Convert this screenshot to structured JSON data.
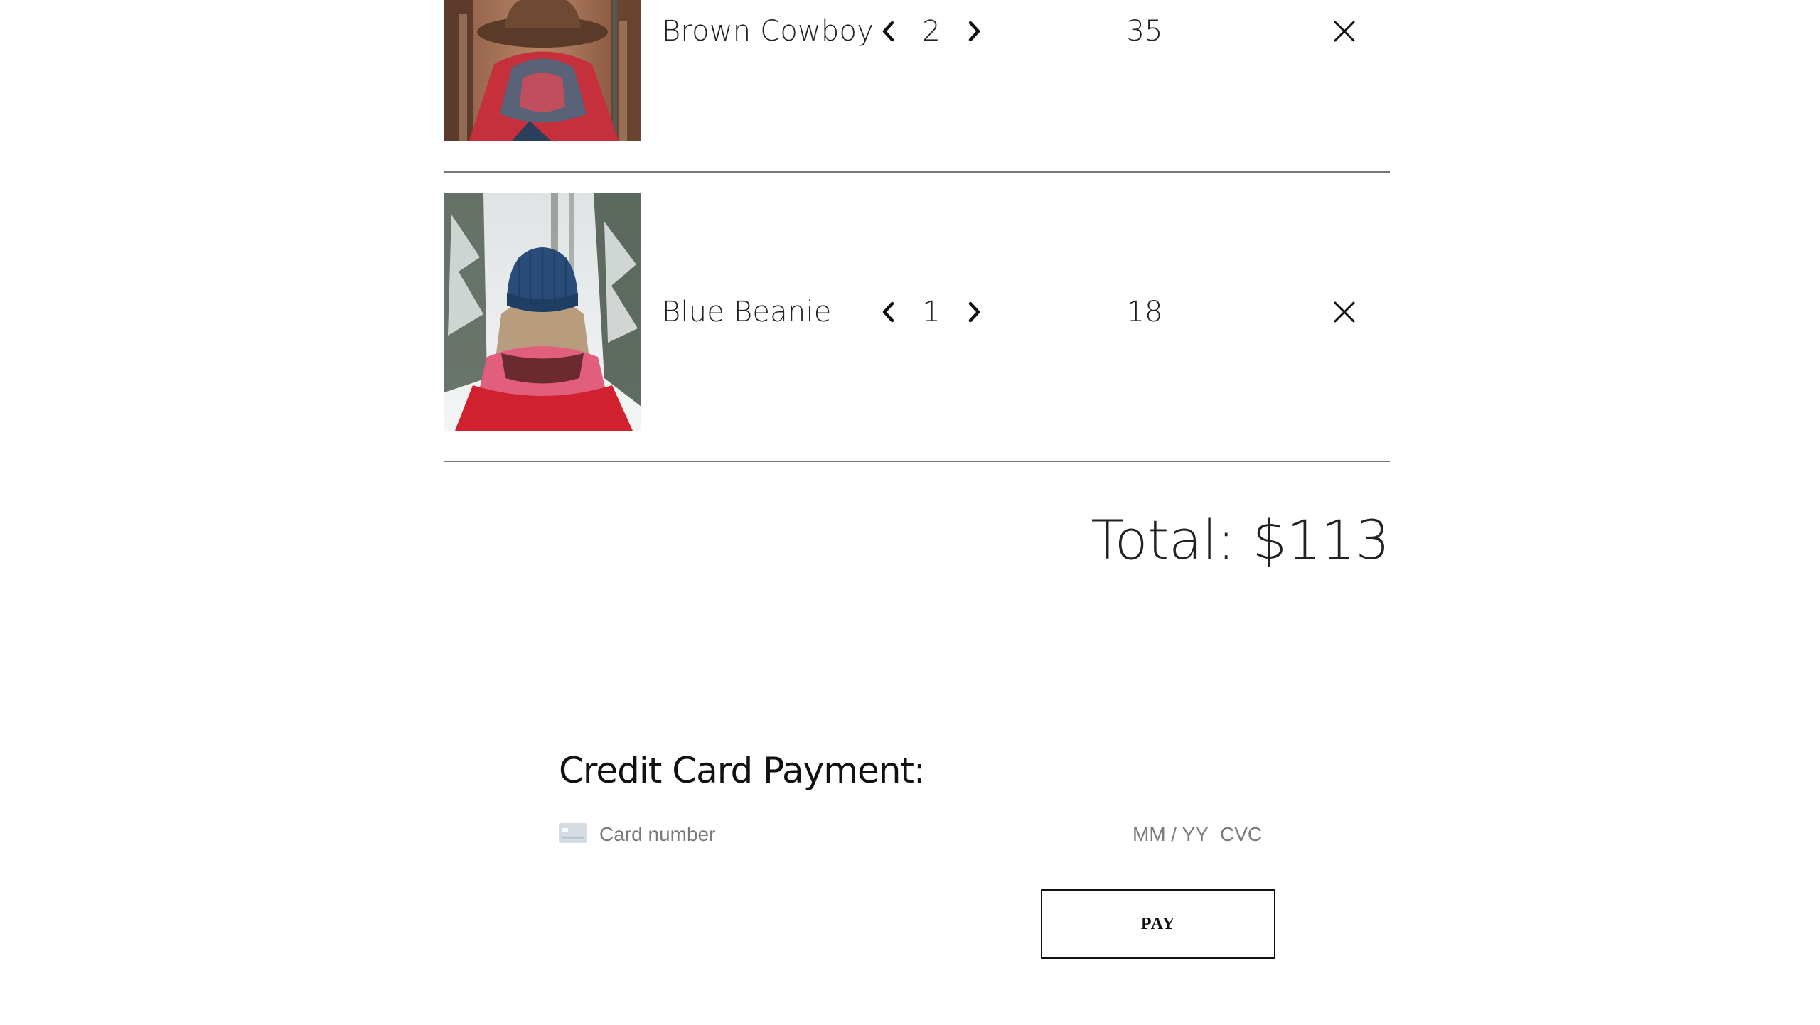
{
  "cart": {
    "items": [
      {
        "name": "Brown Cowboy",
        "quantity": "2",
        "price": "35",
        "image": "brown-cowboy-hat-photo"
      },
      {
        "name": "Blue Beanie",
        "quantity": "1",
        "price": "18",
        "image": "blue-beanie-photo"
      }
    ],
    "total_label": "Total: $113"
  },
  "payment": {
    "title": "Credit Card Payment:",
    "card_number_placeholder": "Card number",
    "expiry_placeholder": "MM / YY",
    "cvc_placeholder": "CVC",
    "pay_label": "PAY"
  },
  "icons": {
    "decrement": "chevron-left-icon",
    "increment": "chevron-right-icon",
    "remove": "close-icon",
    "card": "credit-card-icon"
  }
}
